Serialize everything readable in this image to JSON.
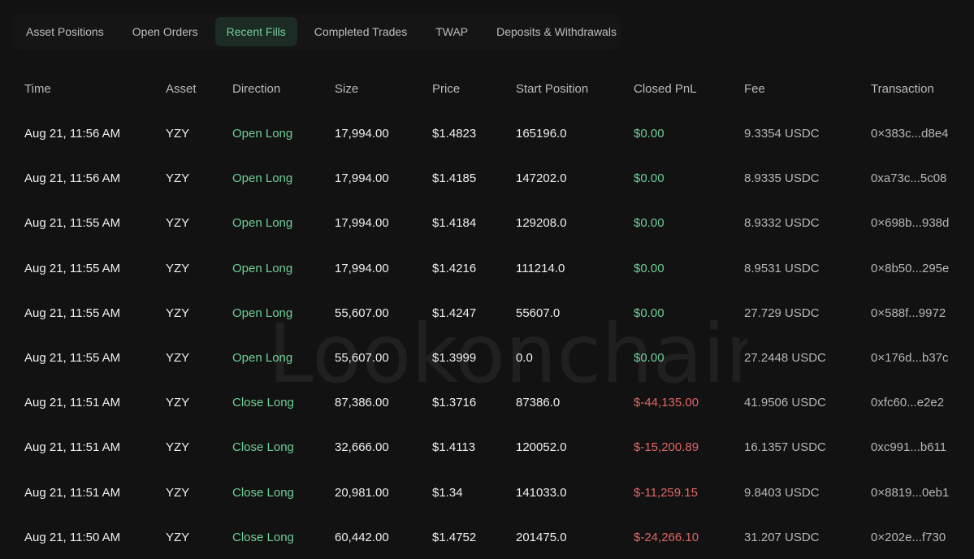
{
  "tabs": [
    {
      "label": "Asset Positions",
      "active": false
    },
    {
      "label": "Open Orders",
      "active": false
    },
    {
      "label": "Recent Fills",
      "active": true
    },
    {
      "label": "Completed Trades",
      "active": false
    },
    {
      "label": "TWAP",
      "active": false
    },
    {
      "label": "Deposits & Withdrawals",
      "active": false
    }
  ],
  "table": {
    "headers": {
      "time": "Time",
      "asset": "Asset",
      "direction": "Direction",
      "size": "Size",
      "price": "Price",
      "start_position": "Start Position",
      "closed_pnl": "Closed PnL",
      "fee": "Fee",
      "transaction": "Transaction"
    },
    "rows": [
      {
        "time": "Aug 21, 11:56 AM",
        "asset": "YZY",
        "direction": "Open Long",
        "size": "17,994.00",
        "price": "$1.4823",
        "start_position": "165196.0",
        "closed_pnl": "$0.00",
        "fee": "9.3354 USDC",
        "transaction": "0×383c...d8e4"
      },
      {
        "time": "Aug 21, 11:56 AM",
        "asset": "YZY",
        "direction": "Open Long",
        "size": "17,994.00",
        "price": "$1.4185",
        "start_position": "147202.0",
        "closed_pnl": "$0.00",
        "fee": "8.9335 USDC",
        "transaction": "0xa73c...5c08"
      },
      {
        "time": "Aug 21, 11:55 AM",
        "asset": "YZY",
        "direction": "Open Long",
        "size": "17,994.00",
        "price": "$1.4184",
        "start_position": "129208.0",
        "closed_pnl": "$0.00",
        "fee": "8.9332 USDC",
        "transaction": "0×698b...938d"
      },
      {
        "time": "Aug 21, 11:55 AM",
        "asset": "YZY",
        "direction": "Open Long",
        "size": "17,994.00",
        "price": "$1.4216",
        "start_position": "111214.0",
        "closed_pnl": "$0.00",
        "fee": "8.9531 USDC",
        "transaction": "0×8b50...295e"
      },
      {
        "time": "Aug 21, 11:55 AM",
        "asset": "YZY",
        "direction": "Open Long",
        "size": "55,607.00",
        "price": "$1.4247",
        "start_position": "55607.0",
        "closed_pnl": "$0.00",
        "fee": "27.729 USDC",
        "transaction": "0×588f...9972"
      },
      {
        "time": "Aug 21, 11:55 AM",
        "asset": "YZY",
        "direction": "Open Long",
        "size": "55,607.00",
        "price": "$1.3999",
        "start_position": "0.0",
        "closed_pnl": "$0.00",
        "fee": "27.2448 USDC",
        "transaction": "0×176d...b37c"
      },
      {
        "time": "Aug 21, 11:51 AM",
        "asset": "YZY",
        "direction": "Close Long",
        "size": "87,386.00",
        "price": "$1.3716",
        "start_position": "87386.0",
        "closed_pnl": "$-44,135.00",
        "fee": "41.9506 USDC",
        "transaction": "0xfc60...e2e2"
      },
      {
        "time": "Aug 21, 11:51 AM",
        "asset": "YZY",
        "direction": "Close Long",
        "size": "32,666.00",
        "price": "$1.4113",
        "start_position": "120052.0",
        "closed_pnl": "$-15,200.89",
        "fee": "16.1357 USDC",
        "transaction": "0xc991...b611"
      },
      {
        "time": "Aug 21, 11:51 AM",
        "asset": "YZY",
        "direction": "Close Long",
        "size": "20,981.00",
        "price": "$1.34",
        "start_position": "141033.0",
        "closed_pnl": "$-11,259.15",
        "fee": "9.8403 USDC",
        "transaction": "0×8819...0eb1"
      },
      {
        "time": "Aug 21, 11:50 AM",
        "asset": "YZY",
        "direction": "Close Long",
        "size": "60,442.00",
        "price": "$1.4752",
        "start_position": "201475.0",
        "closed_pnl": "$-24,266.10",
        "fee": "31.207 USDC",
        "transaction": "0×202e...f730"
      }
    ]
  },
  "colors": {
    "positive": "#6fcf97",
    "negative": "#e06666",
    "active_tab_bg": "#1c2b23"
  }
}
